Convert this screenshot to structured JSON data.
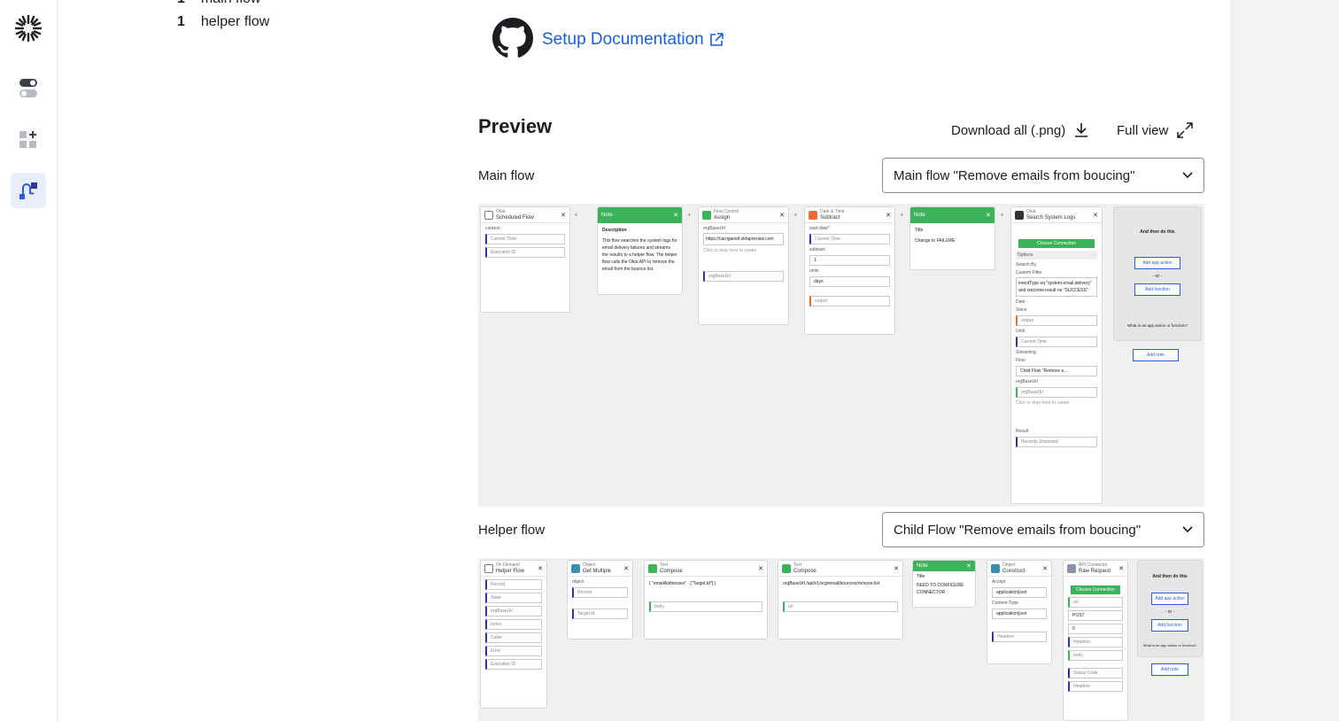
{
  "left_panel": {
    "items": [
      {
        "count": "1",
        "label": "main flow"
      },
      {
        "count": "1",
        "label": "helper flow"
      }
    ]
  },
  "main": {
    "setup_doc_label": "Setup Documentation",
    "preview_title": "Preview",
    "download_label": "Download all (.png)",
    "fullview_label": "Full view",
    "main_flow_label": "Main flow",
    "main_flow_select": "Main flow \"Remove emails from boucing\"",
    "helper_flow_label": "Helper flow",
    "helper_flow_select": "Child Flow \"Remove emails from boucing\""
  },
  "main_canvas": {
    "scheduled": {
      "app": "Okta",
      "title": "Scheduled Flow",
      "ctx": "context",
      "f1": "Current Time",
      "f2": "Execution ID"
    },
    "note1": {
      "hdr": "Note",
      "title": "Description",
      "body": "This flow searches the system logs for email delivery failures and streams the results to a helper flow. The helper flow calls the Okta API to remove the email from the bounce list."
    },
    "assign": {
      "app": "Flow Control",
      "title": "Assign",
      "lbl": "orgBaseUrl",
      "val": "https://carriganwf.oktapreview.com",
      "hint": "Click or drop here to create",
      "out": "orgBaseUrl"
    },
    "subtract": {
      "app": "Date & Time",
      "title": "Subtract",
      "l1": "start date*",
      "v1": "Current Time",
      "l2": "subtract",
      "v2": "1",
      "l3": "units",
      "v3": "days",
      "out": "output"
    },
    "note2": {
      "hdr": "Note",
      "title": "Title",
      "body": "Change to FAILURE"
    },
    "syslog": {
      "app": "Okta",
      "title": "Search System Logs",
      "conn": "Choose Connection",
      "opts": "Options",
      "sb": "Search By",
      "cf": "Custom Filter",
      "cfv": "eventType eq \"system.email.delivery\" and outcome.result ne \"SUCCESS\"",
      "date": "Date",
      "since": "Since",
      "sv": "output",
      "until": "Until",
      "uv": "Current Time",
      "stream": "Streaming",
      "flow": "Flow",
      "fv": "Child Flow \"Remove e...",
      "obu": "orgBaseUrl",
      "obv": "orgBaseUrl",
      "hint": "Click or drop here to create",
      "res": "Result",
      "rv": "Records Streamed"
    },
    "then": {
      "title": "And then do this",
      "b1": "Add app action",
      "or": "- or -",
      "b2": "Add function",
      "q": "What is an app action or function?",
      "note": "Add note"
    }
  },
  "helper_canvas": {
    "c1": {
      "app": "On Demand",
      "title": "Helper Flow",
      "f": [
        "Record",
        "State",
        "orgBaseUrl",
        "Index",
        "Caller",
        "Error",
        "Execution ID"
      ]
    },
    "c2": {
      "app": "Object",
      "title": "Get Multiple",
      "lbl": "object",
      "f1": "Record",
      "f2": "Target.Id"
    },
    "c3": {
      "app": "Text",
      "title": "Compose",
      "body": "{ \"emailAddresses\" : [\"Target.Id\"] }",
      "out": "body"
    },
    "c4": {
      "app": "Text",
      "title": "Compose",
      "body": "orgBaseUrl /api/v1/org/email/bounces/remove-list",
      "out": "url"
    },
    "c5": {
      "hdr": "Note",
      "title": "Title",
      "body": "NEED TO CONFIGURE CONNECTOR"
    },
    "c6": {
      "app": "Object",
      "title": "Construct",
      "l1": "Accept",
      "v1": "application/json",
      "l2": "Content-Type",
      "v2": "application/json",
      "out": "Headers"
    },
    "c7": {
      "app": "API Connector",
      "title": "Raw Request",
      "conn": "Choose Connection",
      "url": "url",
      "m": "POST",
      "q": "0",
      "h": "Headers",
      "b": "body",
      "sc": "Status Code",
      "hd": "Headers"
    },
    "then": {
      "title": "And then do this",
      "b1": "Add app action",
      "or": "- or -",
      "b2": "Add function",
      "q": "What is an app action or function?",
      "note": "Add note"
    }
  },
  "colors": {
    "accent": "#1a5fd6",
    "green": "#3cb25b",
    "orange": "#e8693a",
    "navy": "#2b3a8f"
  }
}
